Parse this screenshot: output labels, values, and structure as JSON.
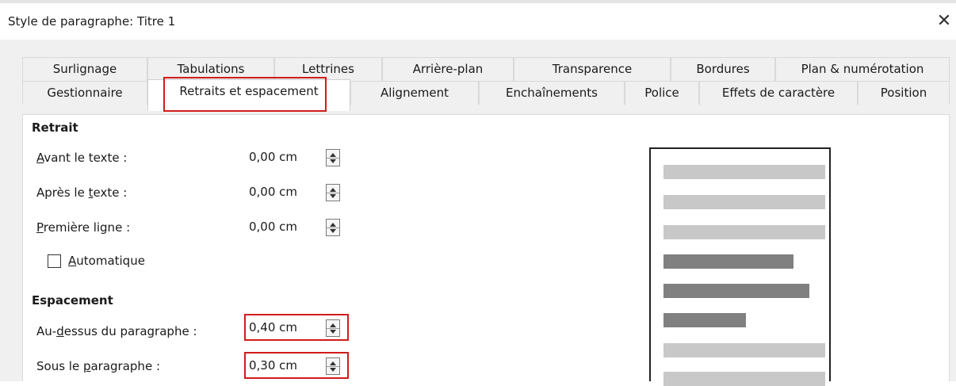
{
  "window": {
    "title": "Style de paragraphe: Titre 1",
    "close_glyph": "✕"
  },
  "tabs_row1": [
    "Surlignage",
    "Tabulations",
    "Lettrines",
    "Arrière-plan",
    "Transparence",
    "Bordures",
    "Plan & numérotation"
  ],
  "tabs_row2": [
    "Gestionnaire",
    "Retraits et espacement",
    "Alignement",
    "Enchaînements",
    "Police",
    "Effets de caractère",
    "Position"
  ],
  "active_tab": "Retraits et espacement",
  "indent": {
    "heading": "Retrait",
    "before_text": {
      "label_pre": "",
      "label_u": "A",
      "label_post": "vant le texte :",
      "value": "0,00 cm"
    },
    "after_text": {
      "label_pre": "Après le ",
      "label_u": "t",
      "label_post": "exte :",
      "value": "0,00 cm"
    },
    "first_line": {
      "label_pre": "",
      "label_u": "P",
      "label_post": "remière ligne :",
      "value": "0,00 cm"
    },
    "automatic": {
      "label_pre": "",
      "label_u": "A",
      "label_post": "utomatique",
      "checked": false
    }
  },
  "spacing": {
    "heading": "Espacement",
    "above": {
      "label_pre": "Au-",
      "label_u": "d",
      "label_post": "essus du paragraphe :",
      "value": "0,40 cm"
    },
    "below": {
      "label_pre": "Sous le ",
      "label_u": "p",
      "label_post": "aragraphe :",
      "value": "0,30 cm"
    }
  },
  "highlight_color": "#d01c1c",
  "preview_colors": {
    "light": "#c8c8c8",
    "dark": "#808080"
  }
}
